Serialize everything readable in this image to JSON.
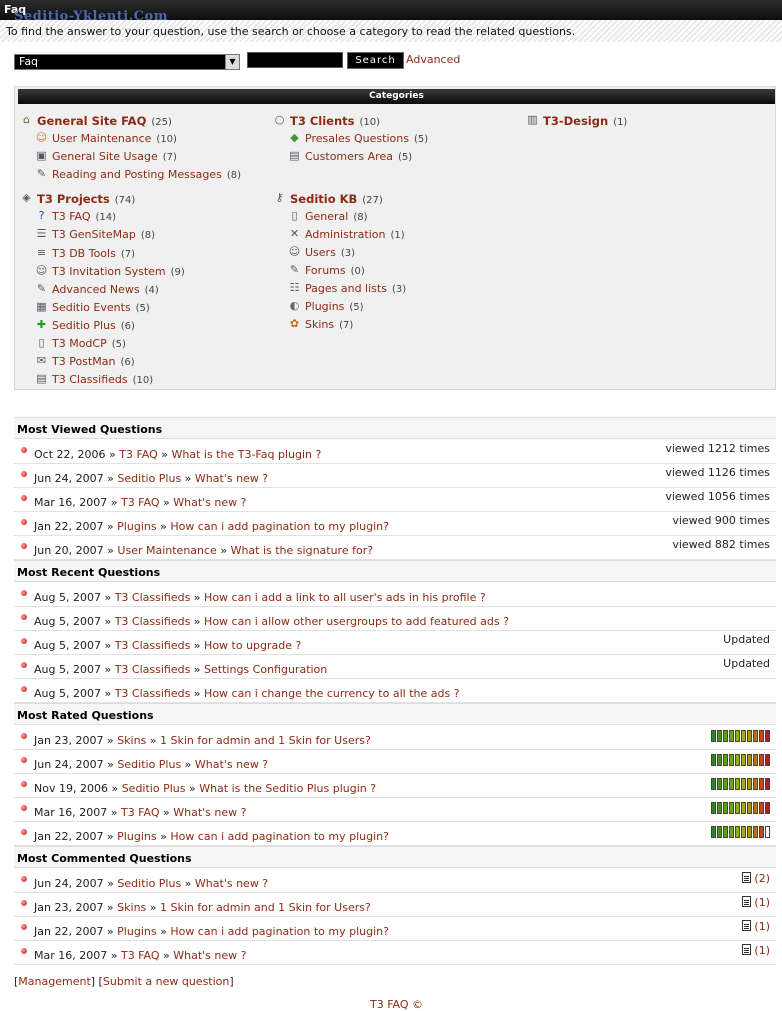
{
  "header": {
    "title": "Faq",
    "watermark": "Seditio-Yklenti.Com",
    "subtitle": "To find the answer to your question, use the search or choose a category to read the related questions."
  },
  "search": {
    "select_value": "Faq",
    "input_value": "",
    "button_label": "Search",
    "advanced_label": "Advanced"
  },
  "categories": {
    "heading": "Categories",
    "col1": [
      {
        "label": "General Site FAQ",
        "count": "(25)",
        "main": true,
        "icon": "home-icon"
      },
      {
        "label": "User Maintenance",
        "count": "(10)",
        "icon": "users-icon"
      },
      {
        "label": "General Site Usage",
        "count": "(7)",
        "icon": "monitor-icon"
      },
      {
        "label": "Reading and Posting Messages",
        "count": "(8)",
        "icon": "note-icon"
      },
      {
        "label": "T3 Projects",
        "count": "(74)",
        "main": true,
        "icon": "projects-icon"
      },
      {
        "label": "T3 FAQ",
        "count": "(14)",
        "icon": "help-icon"
      },
      {
        "label": "T3 GenSiteMap",
        "count": "(8)",
        "icon": "sitemap-icon"
      },
      {
        "label": "T3 DB Tools",
        "count": "(7)",
        "icon": "sql-icon"
      },
      {
        "label": "T3 Invitation System",
        "count": "(9)",
        "icon": "people-icon"
      },
      {
        "label": "Advanced News",
        "count": "(4)",
        "icon": "note-icon"
      },
      {
        "label": "Seditio Events",
        "count": "(5)",
        "icon": "calendar-icon"
      },
      {
        "label": "Seditio Plus",
        "count": "(6)",
        "icon": "plus-icon"
      },
      {
        "label": "T3 ModCP",
        "count": "(5)",
        "icon": "doc-icon"
      },
      {
        "label": "T3 PostMan",
        "count": "(6)",
        "icon": "mail-icon"
      },
      {
        "label": "T3 Classifieds",
        "count": "(10)",
        "icon": "drive-icon"
      }
    ],
    "col2": [
      {
        "label": "T3 Clients",
        "count": "(10)",
        "main": true,
        "icon": "circle-icon"
      },
      {
        "label": "Presales Questions",
        "count": "(5)",
        "icon": "cart-icon"
      },
      {
        "label": "Customers Area",
        "count": "(5)",
        "icon": "drive-icon"
      },
      {
        "label": "Seditio KB",
        "count": "(27)",
        "main": true,
        "icon": "key-icon"
      },
      {
        "label": "General",
        "count": "(8)",
        "icon": "doc-icon"
      },
      {
        "label": "Administration",
        "count": "(1)",
        "icon": "admin-icon"
      },
      {
        "label": "Users",
        "count": "(3)",
        "icon": "people-icon"
      },
      {
        "label": "Forums",
        "count": "(0)",
        "icon": "note-icon"
      },
      {
        "label": "Pages and lists",
        "count": "(3)",
        "icon": "list-icon"
      },
      {
        "label": "Plugins",
        "count": "(5)",
        "icon": "plugin-icon"
      },
      {
        "label": "Skins",
        "count": "(7)",
        "icon": "palette-icon"
      }
    ],
    "col3": [
      {
        "label": "T3-Design",
        "count": "(1)",
        "main": true,
        "icon": "design-icon"
      }
    ]
  },
  "sections": [
    {
      "title": "Most Viewed Questions",
      "kind": "viewed",
      "rows": [
        {
          "date": "Oct 22, 2006",
          "cat": "T3 FAQ",
          "q": "What is the T3-Faq plugin ?",
          "right": "viewed 1212 times"
        },
        {
          "date": "Jun 24, 2007",
          "cat": "Seditio Plus",
          "q": "What's new ?",
          "right": "viewed 1126 times"
        },
        {
          "date": "Mar 16, 2007",
          "cat": "T3 FAQ",
          "q": "What's new ?",
          "right": "viewed 1056 times"
        },
        {
          "date": "Jan 22, 2007",
          "cat": "Plugins",
          "q": "How can i add pagination to my plugin?",
          "right": "viewed 900 times"
        },
        {
          "date": "Jun 20, 2007",
          "cat": "User Maintenance",
          "q": "What is the signature for?",
          "right": "viewed 882 times"
        }
      ]
    },
    {
      "title": "Most Recent Questions",
      "kind": "recent",
      "rows": [
        {
          "date": "Aug 5, 2007",
          "cat": "T3 Classifieds",
          "q": "How can i add a link to all user's ads in his profile ?",
          "right": ""
        },
        {
          "date": "Aug 5, 2007",
          "cat": "T3 Classifieds",
          "q": "How can i allow other usergroups to add featured ads ?",
          "right": ""
        },
        {
          "date": "Aug 5, 2007",
          "cat": "T3 Classifieds",
          "q": "How to upgrade ?",
          "right": "Updated"
        },
        {
          "date": "Aug 5, 2007",
          "cat": "T3 Classifieds",
          "q": "Settings Configuration",
          "right": "Updated"
        },
        {
          "date": "Aug 5, 2007",
          "cat": "T3 Classifieds",
          "q": "How can i change the currency to all the ads ?",
          "right": ""
        }
      ]
    },
    {
      "title": "Most Rated Questions",
      "kind": "rated",
      "rows": [
        {
          "date": "Jan 23, 2007",
          "cat": "Skins",
          "q": "1 Skin for admin and 1 Skin for Users?",
          "rating": 10
        },
        {
          "date": "Jun 24, 2007",
          "cat": "Seditio Plus",
          "q": "What's new ?",
          "rating": 10
        },
        {
          "date": "Nov 19, 2006",
          "cat": "Seditio Plus",
          "q": "What is the Seditio Plus plugin ?",
          "rating": 10
        },
        {
          "date": "Mar 16, 2007",
          "cat": "T3 FAQ",
          "q": "What's new ?",
          "rating": 10
        },
        {
          "date": "Jan 22, 2007",
          "cat": "Plugins",
          "q": "How can i add pagination to my plugin?",
          "rating": 9
        }
      ]
    },
    {
      "title": "Most Commented Questions",
      "kind": "commented",
      "rows": [
        {
          "date": "Jun 24, 2007",
          "cat": "Seditio Plus",
          "q": "What's new ?",
          "right": "(2)"
        },
        {
          "date": "Jan 23, 2007",
          "cat": "Skins",
          "q": "1 Skin for admin and 1 Skin for Users?",
          "right": "(1)"
        },
        {
          "date": "Jan 22, 2007",
          "cat": "Plugins",
          "q": "How can i add pagination to my plugin?",
          "right": "(1)"
        },
        {
          "date": "Mar 16, 2007",
          "cat": "T3 FAQ",
          "q": "What's new ?",
          "right": "(1)"
        }
      ]
    }
  ],
  "footer": {
    "management": "Management",
    "submit": "Submit a new question",
    "copyright": "T3 FAQ ©"
  },
  "colors": {
    "link": "#8b2b14",
    "bar_green": "#2f8a1e",
    "bar_red": "#b32018"
  }
}
